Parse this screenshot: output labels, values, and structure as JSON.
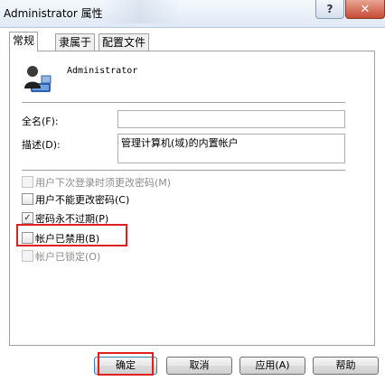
{
  "window": {
    "title": "Administrator 属性",
    "help_label": "?",
    "close_label": "✕"
  },
  "tabs": [
    {
      "label": "常规",
      "active": true
    },
    {
      "label": "隶属于",
      "active": false
    },
    {
      "label": "配置文件",
      "active": false
    }
  ],
  "user": {
    "name": "Administrator",
    "icon": "user-account-icon"
  },
  "fields": {
    "fullname_label": "全名(F):",
    "fullname_value": "",
    "description_label": "描述(D):",
    "description_value": "管理计算机(域)的内置帐户"
  },
  "checkboxes": [
    {
      "label": "用户下次登录时须更改密码(M)",
      "checked": false,
      "disabled": true
    },
    {
      "label": "用户不能更改密码(C)",
      "checked": false,
      "disabled": false
    },
    {
      "label": "密码永不过期(P)",
      "checked": true,
      "disabled": false
    },
    {
      "label": "帐户已禁用(B)",
      "checked": false,
      "disabled": false
    },
    {
      "label": "帐户已锁定(O)",
      "checked": false,
      "disabled": true
    }
  ],
  "buttons": {
    "ok": "确定",
    "cancel": "取消",
    "apply": "应用(A)",
    "help": "帮助"
  },
  "colors": {
    "highlight": "#e02020"
  }
}
